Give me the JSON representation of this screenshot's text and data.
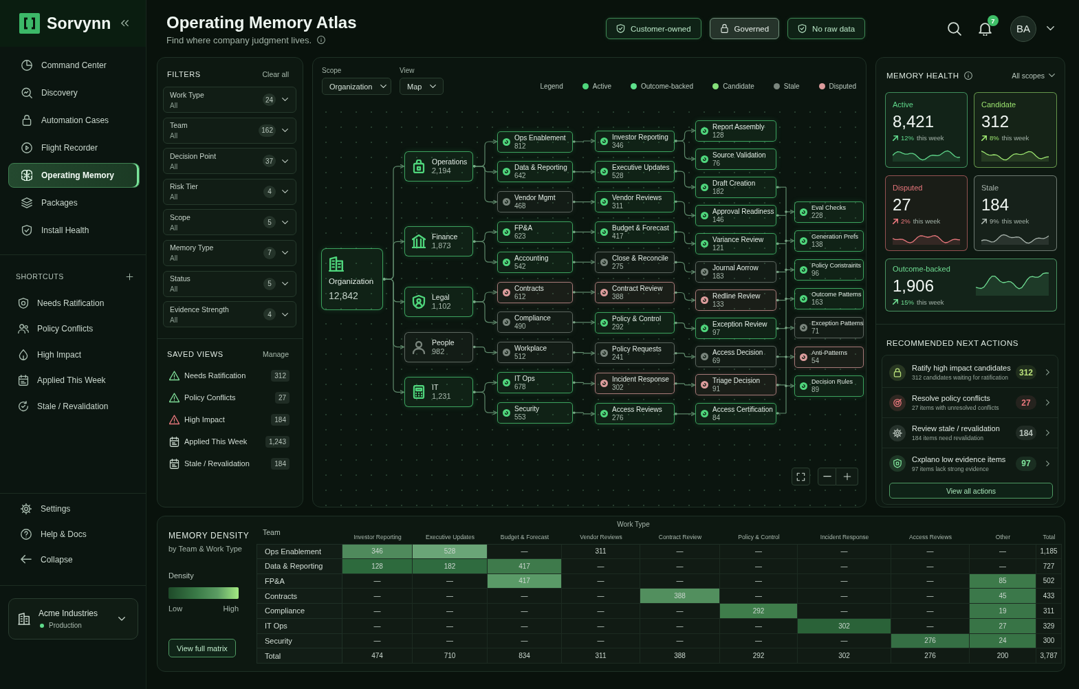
{
  "sidebar": {
    "brand": "Sorvynn",
    "nav": [
      {
        "label": "Command Center",
        "selected": false
      },
      {
        "label": "Discovery",
        "selected": false
      },
      {
        "label": "Automation Cases",
        "selected": false
      },
      {
        "label": "Flight Recorder",
        "selected": false
      },
      {
        "label": "Operating Memory",
        "selected": true
      },
      {
        "label": "Packages",
        "selected": false
      },
      {
        "label": "Install Health",
        "selected": false
      }
    ],
    "shortcuts": {
      "title": "SHORTCUTS",
      "items": [
        "Needs Ratification",
        "Policy Conflicts",
        "High Impact",
        "Applied This Week",
        "Stale / Revalidation"
      ]
    },
    "footer": [
      "Settings",
      "Help & Docs",
      "Collapse"
    ],
    "workspace": {
      "name": "Acme Industries",
      "environment": "Production"
    }
  },
  "header": {
    "title": "Operating Memory Atlas",
    "subtitle": "Find where company judgment lives.",
    "chips": [
      {
        "label": "Customer-owned",
        "kind": "shield"
      },
      {
        "label": "Governed",
        "kind": "lock"
      },
      {
        "label": "No raw data",
        "kind": "shield"
      }
    ],
    "notifications": "7",
    "avatar": "BA"
  },
  "filters": {
    "title": "FILTERS",
    "clear": "Clear all",
    "items": [
      {
        "label": "Work Type",
        "value": "All",
        "count": "24"
      },
      {
        "label": "Team",
        "value": "All",
        "count": "162"
      },
      {
        "label": "Decision Point",
        "value": "All",
        "count": "37"
      },
      {
        "label": "Risk Tier",
        "value": "All",
        "count": "4"
      },
      {
        "label": "Scope",
        "value": "All",
        "count": "5"
      },
      {
        "label": "Memory Type",
        "value": "All",
        "count": "7"
      },
      {
        "label": "Status",
        "value": "All",
        "count": "5"
      },
      {
        "label": "Evidence Strength",
        "value": "All",
        "count": "4"
      }
    ]
  },
  "saved_views": {
    "title": "SAVED VIEWS",
    "action": "Manage",
    "items": [
      {
        "label": "Needs Ratification",
        "count": "312",
        "kind": "warning"
      },
      {
        "label": "Policy Conflicts",
        "count": "27",
        "kind": "warning"
      },
      {
        "label": "High Impact",
        "count": "184",
        "kind": "critical"
      },
      {
        "label": "Applied This Week",
        "count": "1,243",
        "kind": "calendar"
      },
      {
        "label": "Stale / Revalidation",
        "count": "184",
        "kind": "calendar"
      }
    ]
  },
  "map": {
    "scope": {
      "label": "Scope",
      "value": "Organization"
    },
    "view": {
      "label": "View",
      "value": "Map"
    },
    "legend": {
      "title": "Legend",
      "items": [
        {
          "label": "Active",
          "color": "#4fd67c"
        },
        {
          "label": "Outcome-backed",
          "color": "#5ee08c"
        },
        {
          "label": "Candidate",
          "color": "#86e07a"
        },
        {
          "label": "Stale",
          "color": "#7a857d"
        },
        {
          "label": "Disputed",
          "color": "#dc9c9c"
        }
      ]
    },
    "root": {
      "name": "Organization",
      "count": "12,842",
      "color": "#4fd67c",
      "children": [
        {
          "name": "Operations",
          "count": "2,194",
          "color": "#4fd67c",
          "children": [
            {
              "name": "Ops Enablement",
              "count": "812",
              "color": "#4fd67c",
              "children": [
                {
                  "name": "Investor Reporting",
                  "count": "346",
                  "color": "#4fd67c",
                  "children": [
                    {
                      "name": "Report Assembly",
                      "count": "128",
                      "color": "#4fd67c",
                      "feeds_outputs": false
                    },
                    {
                      "name": "Source Validation",
                      "count": "76",
                      "color": "#4fd67c",
                      "feeds_outputs": false
                    }
                  ]
                }
              ]
            },
            {
              "name": "Data & Reporting",
              "count": "642",
              "color": "#4fd67c",
              "children": [
                {
                  "name": "Executive Updates",
                  "count": "528",
                  "color": "#4fd67c",
                  "children": [
                    {
                      "name": "Draft Creation",
                      "count": "182",
                      "color": "#4fd67c",
                      "feeds_outputs": true
                    }
                  ]
                }
              ]
            },
            {
              "name": "Vendor Mgmt",
              "count": "468",
              "color": "#7a857d",
              "children": [
                {
                  "name": "Vendor Reviews",
                  "count": "311",
                  "color": "#4fd67c",
                  "children": [
                    {
                      "name": "Approval Readiness",
                      "count": "146",
                      "color": "#4fd67c",
                      "feeds_outputs": true
                    }
                  ]
                }
              ]
            }
          ]
        },
        {
          "name": "Finance",
          "count": "1,873",
          "color": "#4fd67c",
          "children": [
            {
              "name": "FP&A",
              "count": "623",
              "color": "#4fd67c",
              "children": [
                {
                  "name": "Budget & Forecast",
                  "count": "417",
                  "color": "#4fd67c",
                  "children": [
                    {
                      "name": "Variance Review",
                      "count": "121",
                      "color": "#4fd67c",
                      "feeds_outputs": true
                    }
                  ]
                }
              ]
            },
            {
              "name": "Accounting",
              "count": "542",
              "color": "#4fd67c",
              "children": [
                {
                  "name": "Close & Reconcile",
                  "count": "275",
                  "color": "#7a857d",
                  "children": [
                    {
                      "name": "Journal Aorrow",
                      "count": "183",
                      "color": "#7a857d",
                      "feeds_outputs": true
                    }
                  ]
                }
              ]
            }
          ]
        },
        {
          "name": "Legal",
          "count": "1,102",
          "color": "#4fd67c",
          "children": [
            {
              "name": "Contracts",
              "count": "612",
              "color": "#dc9c9c",
              "children": [
                {
                  "name": "Contract Review",
                  "count": "388",
                  "color": "#dc9c9c",
                  "children": [
                    {
                      "name": "Redline Review",
                      "count": "133",
                      "color": "#dc9c9c",
                      "feeds_outputs": true
                    }
                  ]
                }
              ]
            },
            {
              "name": "Compliance",
              "count": "490",
              "color": "#7a857d",
              "children": [
                {
                  "name": "Policy & Control",
                  "count": "292",
                  "color": "#4fd67c",
                  "children": [
                    {
                      "name": "Exception Review",
                      "count": "97",
                      "color": "#4fd67c",
                      "feeds_outputs": true
                    }
                  ]
                }
              ]
            }
          ]
        },
        {
          "name": "People",
          "count": "982",
          "color": "#7a857d",
          "children": [
            {
              "name": "Workplace",
              "count": "512",
              "color": "#7a857d",
              "children": [
                {
                  "name": "Policy Requests",
                  "count": "241",
                  "color": "#7a857d",
                  "children": [
                    {
                      "name": "Access Decision",
                      "count": "69",
                      "color": "#7a857d",
                      "feeds_outputs": true
                    }
                  ]
                }
              ]
            }
          ]
        },
        {
          "name": "IT",
          "count": "1,231",
          "color": "#4fd67c",
          "children": [
            {
              "name": "IT Ops",
              "count": "678",
              "color": "#4fd67c",
              "children": [
                {
                  "name": "Incident Response",
                  "count": "302",
                  "color": "#dc9c9c",
                  "children": [
                    {
                      "name": "Triage Decision",
                      "count": "91",
                      "color": "#dc9c9c",
                      "feeds_outputs": true
                    }
                  ]
                }
              ]
            },
            {
              "name": "Security",
              "count": "553",
              "color": "#4fd67c",
              "children": [
                {
                  "name": "Access Reviews",
                  "count": "276",
                  "color": "#4fd67c",
                  "children": [
                    {
                      "name": "Access Certification",
                      "count": "84",
                      "color": "#4fd67c",
                      "feeds_outputs": true
                    }
                  ]
                }
              ]
            }
          ]
        }
      ]
    },
    "outputs": [
      {
        "name": "Eval Checks",
        "count": "228",
        "color": "#4fd67c"
      },
      {
        "name": "Generation Prefs",
        "count": "138",
        "color": "#4fd67c"
      },
      {
        "name": "Policy Constraints",
        "count": "96",
        "color": "#4fd67c"
      },
      {
        "name": "Outcome Patterns",
        "count": "163",
        "color": "#4fd67c"
      },
      {
        "name": "Exception Patterns",
        "count": "71",
        "color": "#7a857d"
      },
      {
        "name": "Anti-Patterns",
        "count": "54",
        "color": "#dc9c9c"
      },
      {
        "name": "Decision Rules",
        "count": "89",
        "color": "#4fd67c"
      }
    ]
  },
  "health": {
    "title": "MEMORY HEALTH",
    "scope": "All scopes",
    "tiles": [
      {
        "label": "Active",
        "value": "8,421",
        "change": "12%",
        "period": "this week",
        "color": "#5fd68a"
      },
      {
        "label": "Candidate",
        "value": "312",
        "change": "8%",
        "period": "this week",
        "color": "#9be36f"
      },
      {
        "label": "Disputed",
        "value": "27",
        "change": "2%",
        "period": "this week",
        "color": "#e8777c"
      },
      {
        "label": "Stale",
        "value": "184",
        "change": "9%",
        "period": "this week",
        "color": "#aab5ae"
      },
      {
        "label": "Outcome-backed",
        "value": "1,906",
        "change": "15%",
        "period": "this week",
        "color": "#6fdc92"
      }
    ]
  },
  "actions": {
    "title": "RECOMMENDED NEXT ACTIONS",
    "items": [
      {
        "title": "Ratify high impact candidates",
        "detail": "312 candidates waiting for ratification",
        "count": "312",
        "color": "#b9e07a"
      },
      {
        "title": "Resolve policy conflicts",
        "detail": "27 items with unresolved conflicts",
        "count": "27",
        "color": "#e8777c"
      },
      {
        "title": "Review stale / revalidation",
        "detail": "184 items need revalidation",
        "count": "184",
        "color": "#b7c2ba"
      },
      {
        "title": "Cxplano low evidence items",
        "detail": "97 items lack strong evidence",
        "count": "97",
        "color": "#7fe39a"
      }
    ],
    "button": "View all actions"
  },
  "density": {
    "title": "MEMORY DENSITY",
    "subtitle": "by Team & Work Type",
    "legend_title": "Density",
    "low": "Low",
    "high": "High",
    "button": "View full matrix",
    "table": {
      "row_header": "Team",
      "group_header": "Work Type",
      "columns": [
        "Investor Reporting",
        "Executive Updates",
        "Budget & Forecast",
        "Vendor Reviews",
        "Contract Review",
        "Policy & Control",
        "Incident Response",
        "Access Reviews",
        "Other",
        "Total"
      ],
      "rows": [
        {
          "team": "Ops Enablement",
          "cells": [
            {
              "value": "346",
              "color": "#4f8a5c"
            },
            {
              "value": "528",
              "color": "#6aa577"
            },
            "—",
            "311",
            "—",
            "—",
            "—",
            "—",
            "—",
            "1,185"
          ]
        },
        {
          "team": "Data & Reporting",
          "cells": [
            {
              "value": "128",
              "color": "#2d6a3d"
            },
            {
              "value": "182",
              "color": "#2f6b3f"
            },
            {
              "value": "417",
              "color": "#3e7a4b"
            },
            "—",
            "—",
            "—",
            "—",
            "—",
            "—",
            "727"
          ]
        },
        {
          "team": "FP&A",
          "cells": [
            "—",
            "—",
            {
              "value": "417",
              "color": "#5a9a67"
            },
            "—",
            "—",
            "—",
            "—",
            "—",
            {
              "value": "85",
              "color": "#3d7a4a"
            },
            "502"
          ]
        },
        {
          "team": "Contracts",
          "cells": [
            "—",
            "—",
            "—",
            "—",
            {
              "value": "388",
              "color": "#528f5e"
            },
            "—",
            "—",
            "—",
            {
              "value": "45",
              "color": "#3b784a"
            },
            "433"
          ]
        },
        {
          "team": "Compliance",
          "cells": [
            "—",
            "—",
            "—",
            "—",
            "—",
            {
              "value": "292",
              "color": "#3f7d4b"
            },
            "—",
            "—",
            {
              "value": "19",
              "color": "#3a7648"
            },
            "311"
          ]
        },
        {
          "team": "IT Ops",
          "cells": [
            "—",
            "—",
            "—",
            "—",
            "—",
            "—",
            {
              "value": "302",
              "color": "#2a6238"
            },
            "—",
            {
              "value": "27",
              "color": "#387446"
            },
            "329"
          ]
        },
        {
          "team": "Security",
          "cells": [
            "—",
            "—",
            "—",
            "—",
            "—",
            "—",
            "—",
            {
              "value": "276",
              "color": "#356f44"
            },
            {
              "value": "24",
              "color": "#377345"
            },
            "300"
          ]
        },
        {
          "team": "Total",
          "cells": [
            "474",
            "710",
            "834",
            "311",
            "388",
            "292",
            "302",
            "276",
            "200",
            "3,787"
          ]
        }
      ]
    }
  }
}
